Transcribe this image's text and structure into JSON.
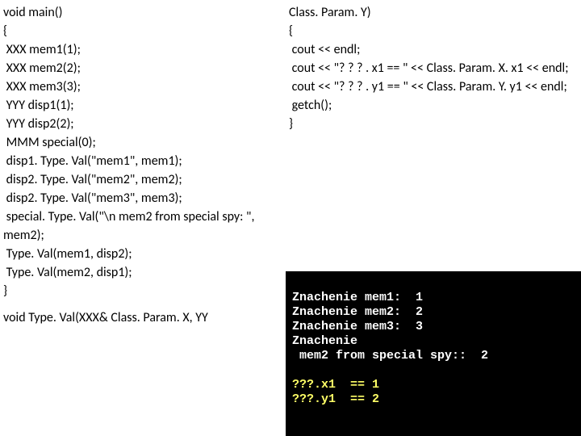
{
  "left": {
    "l0": "void main()",
    "l1": "{",
    "l2": " XXX mem1(1);",
    "l3": " XXX mem2(2);",
    "l4": " XXX mem3(3);",
    "l5": " YYY disp1(1);",
    "l6": " YYY disp2(2);",
    "l7": " MMM special(0);",
    "l8": " disp1. Type. Val(\"mem1\", mem1);",
    "l9": " disp2. Type. Val(\"mem2\", mem2);",
    "l10": " disp2. Type. Val(\"mem3\", mem3);",
    "l11": " special. Type. Val(\"\\n mem2 from special spy: \", mem2);",
    "l12": " Type. Val(mem1, disp2);",
    "l13": " Type. Val(mem2, disp1);",
    "l14": "}",
    "l15": "void Type. Val(XXX& Class. Param. X, YY"
  },
  "right": {
    "r0": "Class. Param. Y)",
    "r1": "{",
    "r2": " cout << endl;",
    "r3": " cout << \"? ? ? . x1 == \" << Class. Param. X. x1 << endl;",
    "r4": " cout << \"? ? ? . y1 == \" << Class. Param. Y. y1 << endl;",
    "r5": " getch();",
    "r6": "}"
  },
  "console": {
    "c0": "Znachenie mem1:  1",
    "c1": "Znachenie mem2:  2",
    "c2": "Znachenie mem3:  3",
    "c3": "Znachenie",
    "c4": " mem2 from special spy::  2",
    "c5": "",
    "c6": "???.x1  == 1",
    "c7": "???.y1  == 2"
  }
}
